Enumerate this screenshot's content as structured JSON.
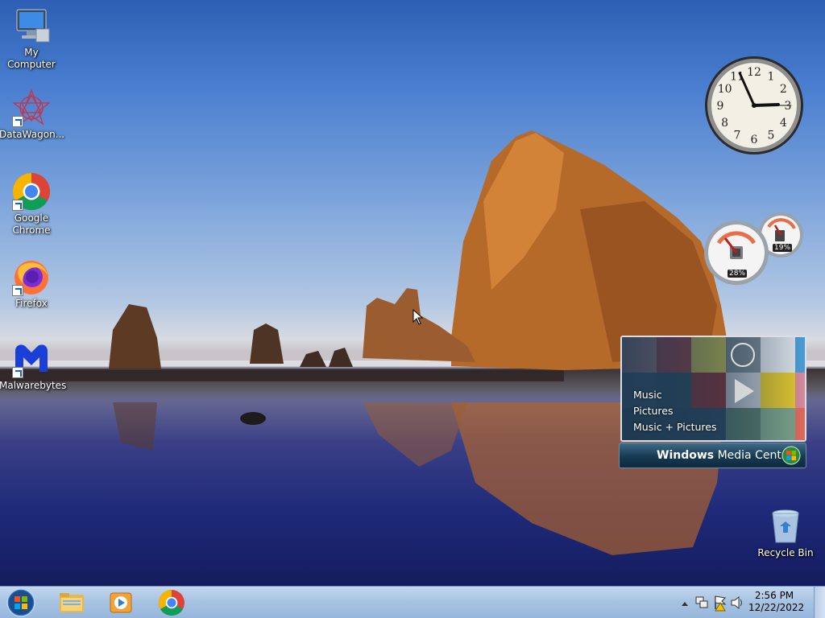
{
  "desktop": {
    "icons": [
      {
        "label": "My Computer"
      },
      {
        "label": "DataWagon..."
      },
      {
        "label": "Google Chrome"
      },
      {
        "label": "Firefox"
      },
      {
        "label": "Malwarebytes"
      },
      {
        "label": "Recycle Bin"
      }
    ]
  },
  "gadgets": {
    "clock": {
      "hour_numbers": [
        "12",
        "1",
        "2",
        "3",
        "4",
        "5",
        "6",
        "7",
        "8",
        "9",
        "10",
        "11"
      ]
    },
    "cpu_meter": {
      "cpu": "28%",
      "memory": "19%",
      "cpu_value": 28,
      "memory_value": 19
    },
    "media_center": {
      "menu": [
        "Music",
        "Pictures",
        "Music + Pictures"
      ],
      "brand_bold": "Windows",
      "brand_rest": " Media Center"
    }
  },
  "taskbar": {
    "clock_time": "2:56 PM",
    "clock_date": "12/22/2022",
    "pinned": [
      {
        "name": "file-explorer"
      },
      {
        "name": "windows-media-player"
      },
      {
        "name": "google-chrome"
      }
    ],
    "tray_icons": [
      "show-hidden-icons",
      "network-icon",
      "action-center-flag-icon",
      "volume-icon"
    ]
  },
  "colors": {
    "taskbar": "#a9c4e2",
    "chrome_red": "#db4437",
    "chrome_green": "#0f9d58",
    "chrome_yellow": "#f4b400",
    "chrome_blue": "#4285f4",
    "malwarebytes_blue": "#1a3fd6",
    "firefox_orange": "#ff7139"
  }
}
